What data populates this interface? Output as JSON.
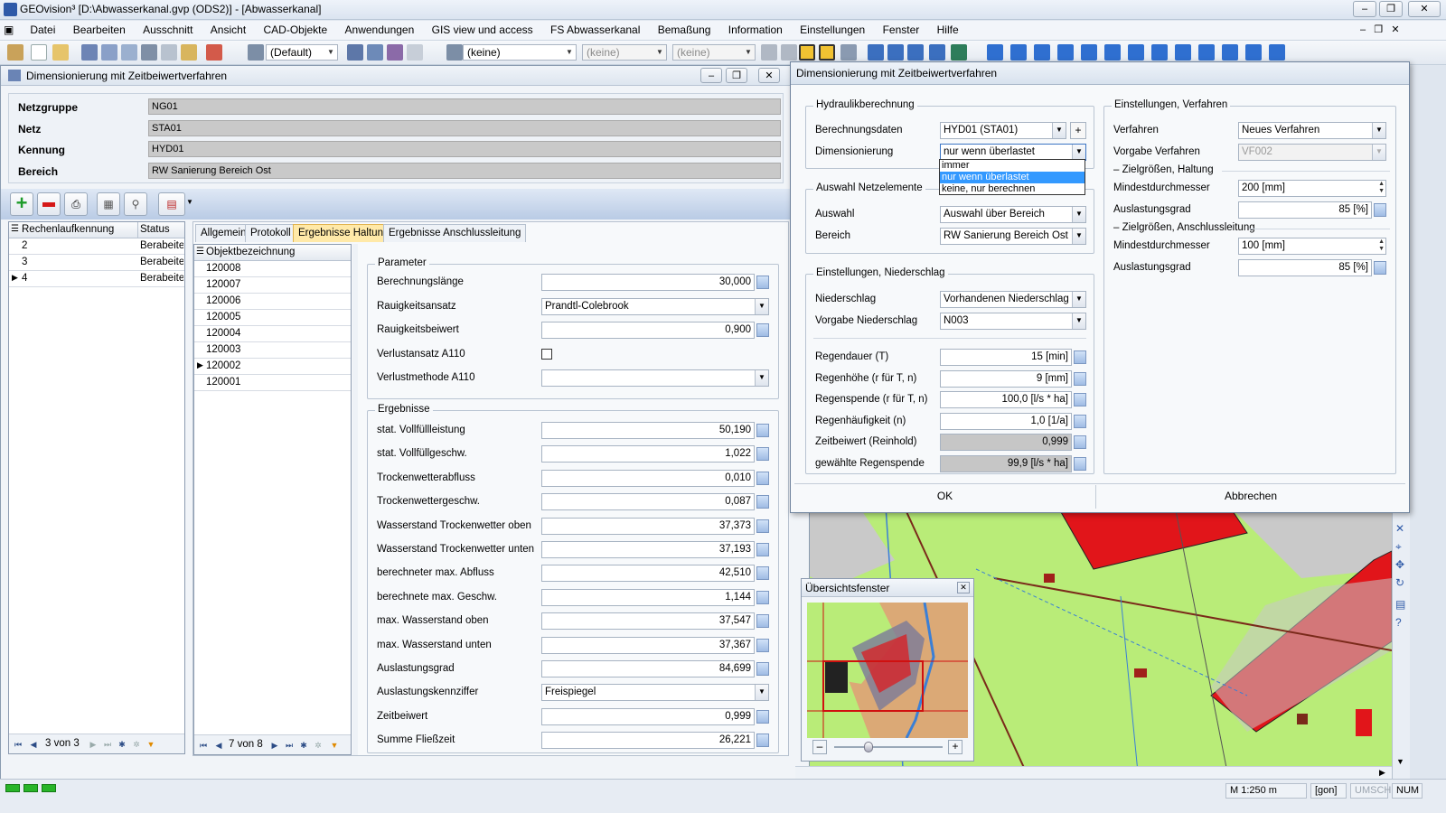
{
  "app": {
    "title": "GEOvision³  [D:\\Abwasserkanal.gvp (ODS2)] - [Abwasserkanal]"
  },
  "menu": [
    "Datei",
    "Bearbeiten",
    "Ausschnitt",
    "Ansicht",
    "CAD-Objekte",
    "Anwendungen",
    "GIS view und access",
    "FS Abwasserkanal",
    "Bemaßung",
    "Information",
    "Einstellungen",
    "Fenster",
    "Hilfe"
  ],
  "toolbar": {
    "combo_default": "(Default)",
    "combo_keine1": "(keine)",
    "combo_keine2": "(keine)",
    "combo_keine3": "(keine)"
  },
  "left_window": {
    "title": "Dimensionierung mit Zeitbeiwertverfahren",
    "header": [
      {
        "label": "Netzgruppe",
        "value": "NG01"
      },
      {
        "label": "Netz",
        "value": "STA01"
      },
      {
        "label": "Kennung",
        "value": "HYD01"
      },
      {
        "label": "Bereich",
        "value": "RW Sanierung Bereich Ost"
      }
    ],
    "runs_grid": {
      "col1": "Rechenlaufkennung",
      "col2": "Status",
      "rows": [
        {
          "id": "2",
          "status": "Berabeite"
        },
        {
          "id": "3",
          "status": "Berabeite"
        },
        {
          "id": "4",
          "status": "Berabeite"
        }
      ],
      "nav": "3 von 3"
    },
    "tabs": [
      "Allgemein",
      "Protokoll",
      "Ergebnisse Haltung",
      "Ergebnisse Anschlussleitung"
    ],
    "objects_grid": {
      "header": "Objektbezeichnung",
      "rows": [
        "120008",
        "120007",
        "120006",
        "120005",
        "120004",
        "120003",
        "120002",
        "120001"
      ],
      "nav": "7 von 8"
    },
    "parameter_title": "Parameter",
    "parameter": [
      {
        "label": "Berechnungslänge",
        "value": "30,000",
        "kind": "num"
      },
      {
        "label": "Rauigkeitsansatz",
        "value": "Prandtl-Colebrook",
        "kind": "combo"
      },
      {
        "label": "Rauigkeitsbeiwert",
        "value": "0,900",
        "kind": "num"
      },
      {
        "label": "Verlustansatz A110",
        "value": "",
        "kind": "check"
      },
      {
        "label": "Verlustmethode A110",
        "value": "",
        "kind": "combo"
      }
    ],
    "results_title": "Ergebnisse",
    "results": [
      {
        "label": "stat. Vollfüllleistung",
        "value": "50,190",
        "kind": "num"
      },
      {
        "label": "stat. Vollfüllgeschw.",
        "value": "1,022",
        "kind": "num"
      },
      {
        "label": "Trockenwetterabfluss",
        "value": "0,010",
        "kind": "num"
      },
      {
        "label": "Trockenwettergeschw.",
        "value": "0,087",
        "kind": "num"
      },
      {
        "label": "Wasserstand Trockenwetter oben",
        "value": "37,373",
        "kind": "num"
      },
      {
        "label": "Wasserstand Trockenwetter unten",
        "value": "37,193",
        "kind": "num"
      },
      {
        "label": "berechneter max. Abfluss",
        "value": "42,510",
        "kind": "num"
      },
      {
        "label": "berechnete max. Geschw.",
        "value": "1,144",
        "kind": "num"
      },
      {
        "label": "max. Wasserstand oben",
        "value": "37,547",
        "kind": "num"
      },
      {
        "label": "max. Wasserstand unten",
        "value": "37,367",
        "kind": "num"
      },
      {
        "label": "Auslastungsgrad",
        "value": "84,699",
        "kind": "num"
      },
      {
        "label": "Auslastungskennziffer",
        "value": "Freispiegel",
        "kind": "combo"
      },
      {
        "label": "Zeitbeiwert",
        "value": "0,999",
        "kind": "num"
      },
      {
        "label": "Summe Fließzeit",
        "value": "26,221",
        "kind": "num"
      }
    ]
  },
  "dialog": {
    "title": "Dimensionierung mit Zeitbeiwertverfahren",
    "hydraulik": {
      "title": "Hydraulikberechnung",
      "berechnungsdaten_label": "Berechnungsdaten",
      "berechnungsdaten_value": "HYD01 (STA01)",
      "dimensionierung_label": "Dimensionierung",
      "dimensionierung_value": "nur wenn überlastet",
      "dropdown_options": [
        "immer",
        "nur wenn überlastet",
        "keine, nur berechnen"
      ]
    },
    "auswahl": {
      "title": "Auswahl Netzelemente",
      "auswahl_label": "Auswahl",
      "auswahl_value": "Auswahl über Bereich",
      "bereich_label": "Bereich",
      "bereich_value": "RW Sanierung Bereich Ost"
    },
    "niederschlag": {
      "title": "Einstellungen, Niederschlag",
      "niederschlag_label": "Niederschlag",
      "niederschlag_value": "Vorhandenen Niederschlag ver",
      "vorgabe_label": "Vorgabe Niederschlag",
      "vorgabe_value": "N003",
      "rows": [
        {
          "label": "Regendauer (T)",
          "value": "15 [min]",
          "gray": false
        },
        {
          "label": "Regenhöhe (r für T, n)",
          "value": "9 [mm]",
          "gray": false
        },
        {
          "label": "Regenspende (r für T, n)",
          "value": "100,0 [l/s * ha]",
          "gray": false
        },
        {
          "label": "Regenhäufigkeit (n)",
          "value": "1,0 [1/a]",
          "gray": false
        },
        {
          "label": "Zeitbeiwert (Reinhold)",
          "value": "0,999",
          "gray": true
        },
        {
          "label": "gewählte Regenspende",
          "value": "99,9 [l/s * ha]",
          "gray": true
        }
      ]
    },
    "verfahren": {
      "title": "Einstellungen, Verfahren",
      "verfahren_label": "Verfahren",
      "verfahren_value": "Neues Verfahren",
      "vorgabe_label": "Vorgabe Verfahren",
      "vorgabe_value": "VF002",
      "sub1": "Zielgrößen, Haltung",
      "h_min_label": "Mindestdurchmesser",
      "h_min_value": "200 [mm]",
      "h_ausl_label": "Auslastungsgrad",
      "h_ausl_value": "85 [%]",
      "sub2": "Zielgrößen, Anschlussleitung",
      "a_min_label": "Mindestdurchmesser",
      "a_min_value": "100 [mm]",
      "a_ausl_label": "Auslastungsgrad",
      "a_ausl_value": "85 [%]"
    },
    "ok": "OK",
    "cancel": "Abbrechen"
  },
  "overview": {
    "title": "Übersichtsfenster",
    "zoom_level": 0.3
  },
  "statusbar": {
    "scale": "M 1:250  m",
    "unit": "[gon]",
    "umsch": "UMSCH",
    "num": "NUM"
  }
}
